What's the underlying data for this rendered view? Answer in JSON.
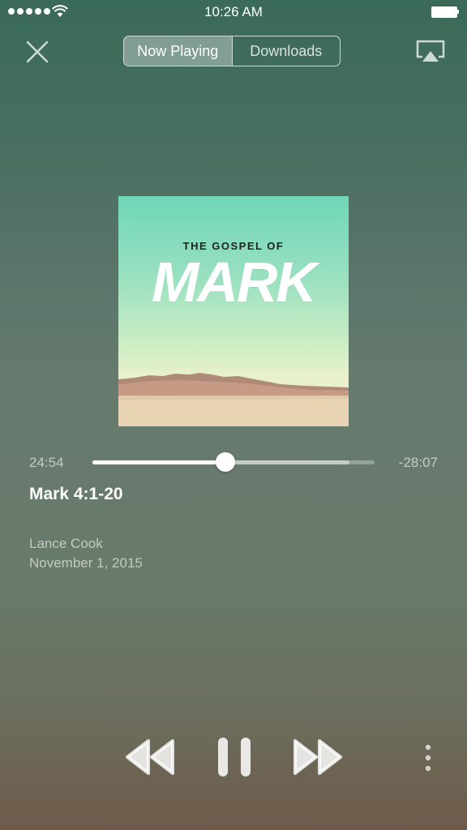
{
  "status_bar": {
    "time": "10:26 AM"
  },
  "nav": {
    "tabs": [
      {
        "label": "Now Playing",
        "active": true
      },
      {
        "label": "Downloads",
        "active": false
      }
    ]
  },
  "artwork": {
    "subtitle": "THE GOSPEL OF",
    "title": "MARK"
  },
  "player": {
    "elapsed": "24:54",
    "remaining": "-28:07",
    "progress_fraction": 0.47,
    "buffered_fraction": 0.91
  },
  "track": {
    "title": "Mark 4:1-20",
    "speaker": "Lance Cook",
    "date": "November 1, 2015"
  },
  "colors": {
    "accent": "#ffffff",
    "artwork_top": "#6fd6b8",
    "artwork_ground": "#e0c9a8"
  }
}
